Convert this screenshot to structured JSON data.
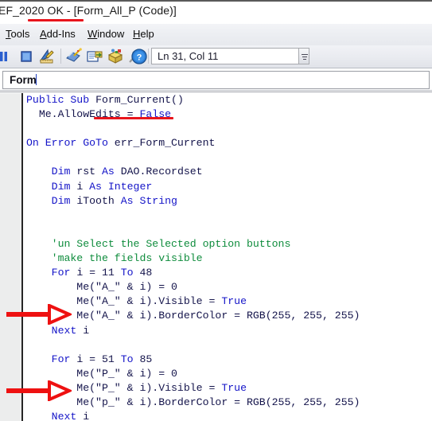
{
  "window": {
    "title": "EF_2020 OK - [Form_All_P (Code)]",
    "title_underline_color": "#e8141c"
  },
  "menubar": {
    "items": [
      {
        "name": "tools",
        "label": "Tools",
        "accesskey": "T"
      },
      {
        "name": "add-ins",
        "label": "Add-Ins",
        "accesskey": "A"
      },
      {
        "name": "window",
        "label": "Window",
        "accesskey": "W"
      },
      {
        "name": "help",
        "label": "Help",
        "accesskey": "H"
      }
    ]
  },
  "toolbar": {
    "icons": [
      {
        "name": "break-icon",
        "glyph": "pause"
      },
      {
        "name": "reset-stop-icon",
        "glyph": "stop"
      },
      {
        "name": "design-mode-icon",
        "glyph": "ruler-pencil"
      },
      {
        "name": "project-explorer-icon",
        "glyph": "folders-pencil"
      },
      {
        "name": "properties-window-icon",
        "glyph": "property-sheet"
      },
      {
        "name": "object-browser-icon",
        "glyph": "object-box"
      },
      {
        "name": "toolbox-icon",
        "glyph": "hammer-wrench"
      },
      {
        "name": "help-icon",
        "glyph": "question-mark"
      }
    ],
    "position_indicator": "Ln 31, Col 11"
  },
  "object_bar": {
    "object_combo_value": "Form",
    "procedure_combo_value": ""
  },
  "code": {
    "language": "VBA",
    "lines": [
      [
        {
          "t": "Public Sub ",
          "c": "kw"
        },
        {
          "t": "Form_Current",
          "c": "id"
        },
        {
          "t": "()",
          "c": "id"
        }
      ],
      [
        {
          "t": "  Me.AllowEdits = ",
          "c": "id"
        },
        {
          "t": "False",
          "c": "kw"
        }
      ],
      [],
      [
        {
          "t": "On Error GoTo ",
          "c": "kw"
        },
        {
          "t": "err_Form_Current",
          "c": "id"
        }
      ],
      [],
      [
        {
          "t": "    ",
          "c": "id"
        },
        {
          "t": "Dim ",
          "c": "kw"
        },
        {
          "t": "rst ",
          "c": "id"
        },
        {
          "t": "As ",
          "c": "kw"
        },
        {
          "t": "DAO.Recordset",
          "c": "id"
        }
      ],
      [
        {
          "t": "    ",
          "c": "id"
        },
        {
          "t": "Dim ",
          "c": "kw"
        },
        {
          "t": "i ",
          "c": "id"
        },
        {
          "t": "As ",
          "c": "kw"
        },
        {
          "t": "Integer",
          "c": "kw"
        }
      ],
      [
        {
          "t": "    ",
          "c": "id"
        },
        {
          "t": "Dim ",
          "c": "kw"
        },
        {
          "t": "iTooth ",
          "c": "id"
        },
        {
          "t": "As ",
          "c": "kw"
        },
        {
          "t": "String",
          "c": "kw"
        }
      ],
      [],
      [],
      [
        {
          "t": "    'un Select the Selected option buttons",
          "c": "cm"
        }
      ],
      [
        {
          "t": "    'make the fields visible",
          "c": "cm"
        }
      ],
      [
        {
          "t": "    ",
          "c": "id"
        },
        {
          "t": "For ",
          "c": "kw"
        },
        {
          "t": "i = 11 ",
          "c": "id"
        },
        {
          "t": "To ",
          "c": "kw"
        },
        {
          "t": "48",
          "c": "id"
        }
      ],
      [
        {
          "t": "        Me(\"A_\" & i) = 0",
          "c": "id"
        }
      ],
      [
        {
          "t": "        Me(\"A_\" & i).Visible = ",
          "c": "id"
        },
        {
          "t": "True",
          "c": "kw"
        }
      ],
      [
        {
          "t": "        Me(\"A_\" & i).BorderColor = RGB(255, 255, 255)",
          "c": "id"
        }
      ],
      [
        {
          "t": "    ",
          "c": "id"
        },
        {
          "t": "Next ",
          "c": "kw"
        },
        {
          "t": "i",
          "c": "id"
        }
      ],
      [],
      [
        {
          "t": "    ",
          "c": "id"
        },
        {
          "t": "For ",
          "c": "kw"
        },
        {
          "t": "i = 51 ",
          "c": "id"
        },
        {
          "t": "To ",
          "c": "kw"
        },
        {
          "t": "85",
          "c": "id"
        }
      ],
      [
        {
          "t": "        Me(\"P_\" & i) = 0",
          "c": "id"
        }
      ],
      [
        {
          "t": "        Me(\"P_\" & i).Visible = ",
          "c": "id"
        },
        {
          "t": "True",
          "c": "kw"
        }
      ],
      [
        {
          "t": "        Me(\"p_\" & i).BorderColor = RGB(255, 255, 255)",
          "c": "id"
        }
      ],
      [
        {
          "t": "    ",
          "c": "id"
        },
        {
          "t": "Next ",
          "c": "kw"
        },
        {
          "t": "i",
          "c": "id"
        }
      ]
    ]
  },
  "annotations": {
    "color": "#ee1111",
    "underline_title": {
      "label": "Form_All_P"
    },
    "underline_procedure": {
      "label": "Form_Current"
    },
    "arrows": [
      {
        "name": "annotation-arrow-upper",
        "target_line": "Me(\"A_\" & i).BorderColor = RGB(255, 255, 255)"
      },
      {
        "name": "annotation-arrow-lower",
        "target_line": "Me(\"p_\" & i).BorderColor = RGB(255, 255, 255)"
      }
    ]
  }
}
